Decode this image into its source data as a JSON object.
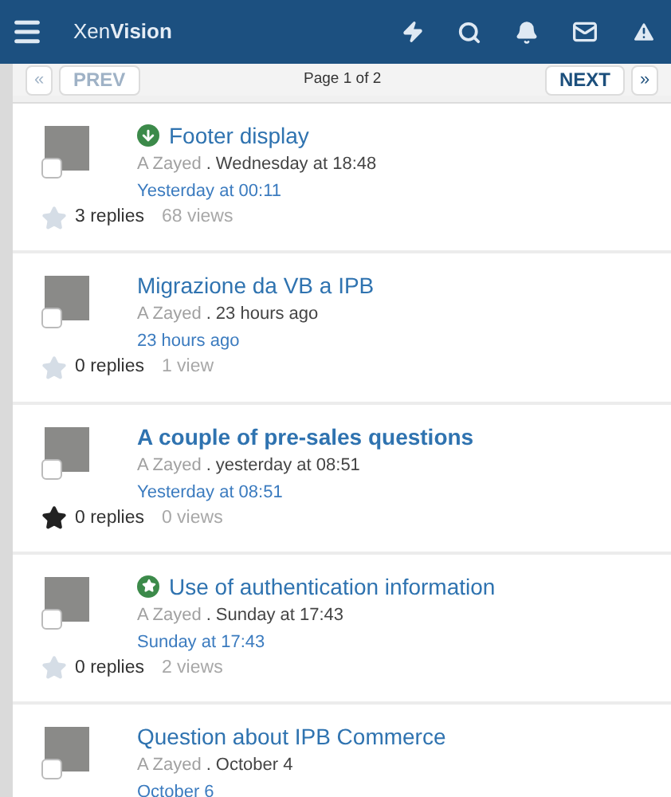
{
  "header": {
    "logo": "Xen**Vision**"
  },
  "pagination": {
    "first": {
      "label": "«",
      "disabled": true
    },
    "prev": {
      "label": "PREV",
      "disabled": true
    },
    "info": "Page 1 of 2",
    "next": {
      "label": "NEXT",
      "disabled": false
    },
    "last": {
      "label": "»",
      "disabled": false
    }
  },
  "topics": [
    {
      "kind": "download",
      "title": "Footer display",
      "unread": false,
      "author": "A Zayed",
      "separator": ".",
      "started": "Wednesday at 18:48",
      "last_post": "Yesterday at 00:11",
      "starred": false,
      "checked": false,
      "replies": "3 replies",
      "views": "68 views"
    },
    {
      "kind": "plain",
      "title": "Migrazione da VB a IPB",
      "unread": false,
      "author": "A Zayed",
      "separator": ".",
      "started": "23 hours ago",
      "last_post": "23 hours ago",
      "starred": false,
      "checked": false,
      "replies": "0 replies",
      "views": "1 view"
    },
    {
      "kind": "plain",
      "title": "A couple of pre-sales questions",
      "unread": true,
      "author": "A Zayed",
      "separator": ".",
      "started": "yesterday at 08:51",
      "last_post": "Yesterday at 08:51",
      "starred": true,
      "checked": false,
      "replies": "0 replies",
      "views": "0 views"
    },
    {
      "kind": "starred-topic",
      "title": "Use of authentication information",
      "unread": false,
      "author": "A Zayed",
      "separator": ".",
      "started": "Sunday at 17:43",
      "last_post": "Sunday at 17:43",
      "starred": false,
      "checked": false,
      "replies": "0 replies",
      "views": "2 views"
    },
    {
      "kind": "plain",
      "title": "Question about IPB Commerce",
      "unread": false,
      "author": "A Zayed",
      "separator": ".",
      "started": "October 4",
      "last_post": "October 6",
      "checked": false
    }
  ]
}
